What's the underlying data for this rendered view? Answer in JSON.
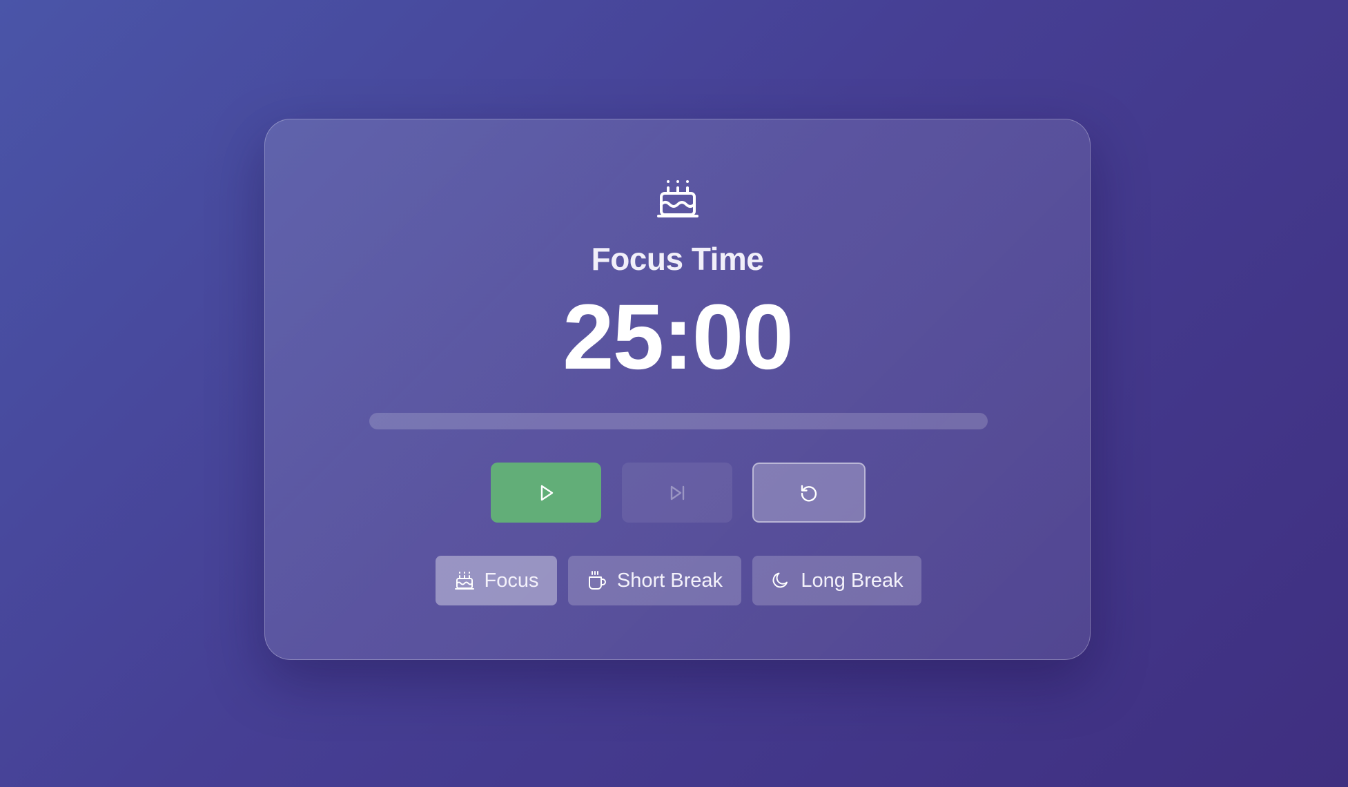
{
  "session": {
    "icon": "cake-icon",
    "title": "Focus Time",
    "time": "25:00",
    "progress_percent": 0
  },
  "controls": {
    "play_icon": "play-icon",
    "skip_icon": "skip-forward-icon",
    "reset_icon": "reset-icon"
  },
  "modes": [
    {
      "label": "Focus",
      "icon": "cake-icon",
      "active": true
    },
    {
      "label": "Short Break",
      "icon": "coffee-cup-icon",
      "active": false
    },
    {
      "label": "Long Break",
      "icon": "moon-icon",
      "active": false
    }
  ],
  "colors": {
    "accent_green": "#62ae78",
    "background_start": "#4a55a8",
    "background_end": "#3f2f80"
  }
}
